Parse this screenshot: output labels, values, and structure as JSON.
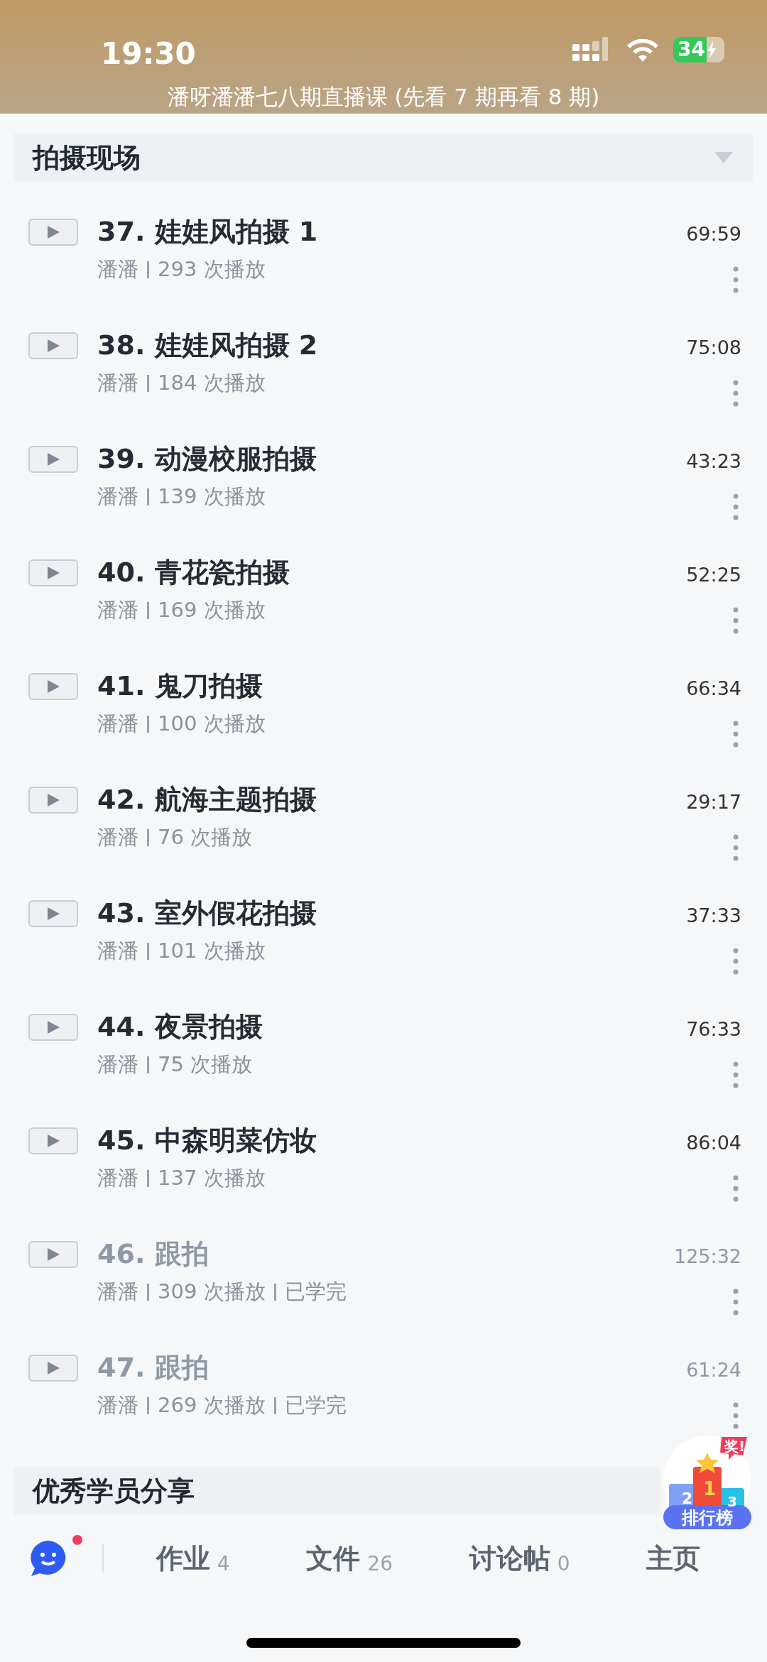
{
  "status_bar": {
    "time": "19:30",
    "battery": "34"
  },
  "course_title": "潘呀潘潘七八期直播课 (先看 7 期再看 8 期)",
  "sections": [
    {
      "title": "拍摄现场",
      "expanded": true,
      "lessons": [
        {
          "title": "37. 娃娃风拍摄 1",
          "author": "潘潘",
          "plays": "293 次播放",
          "duration": "69:59",
          "completed": false
        },
        {
          "title": "38. 娃娃风拍摄 2",
          "author": "潘潘",
          "plays": "184 次播放",
          "duration": "75:08",
          "completed": false
        },
        {
          "title": "39. 动漫校服拍摄",
          "author": "潘潘",
          "plays": "139 次播放",
          "duration": "43:23",
          "completed": false
        },
        {
          "title": "40. 青花瓷拍摄",
          "author": "潘潘",
          "plays": "169 次播放",
          "duration": "52:25",
          "completed": false
        },
        {
          "title": "41. 鬼刀拍摄",
          "author": "潘潘",
          "plays": "100 次播放",
          "duration": "66:34",
          "completed": false
        },
        {
          "title": "42. 航海主题拍摄",
          "author": "潘潘",
          "plays": "76 次播放",
          "duration": "29:17",
          "completed": false
        },
        {
          "title": "43. 室外假花拍摄",
          "author": "潘潘",
          "plays": "101 次播放",
          "duration": "37:33",
          "completed": false
        },
        {
          "title": "44. 夜景拍摄",
          "author": "潘潘",
          "plays": "75 次播放",
          "duration": "76:33",
          "completed": false
        },
        {
          "title": "45. 中森明菜仿妆",
          "author": "潘潘",
          "plays": "137 次播放",
          "duration": "86:04",
          "completed": false
        },
        {
          "title": "46. 跟拍",
          "author": "潘潘",
          "plays": "309 次播放",
          "status": "已学完",
          "duration": "125:32",
          "completed": true
        },
        {
          "title": "47. 跟拍",
          "author": "潘潘",
          "plays": "269 次播放",
          "status": "已学完",
          "duration": "61:24",
          "completed": true
        }
      ]
    },
    {
      "title": "优秀学员分享"
    }
  ],
  "leaderboard": {
    "label": "排行榜",
    "tag": "奖!",
    "places": [
      "2",
      "1",
      "3"
    ]
  },
  "bottom_tabs": [
    {
      "label": "作业",
      "count": "4"
    },
    {
      "label": "文件",
      "count": "26"
    },
    {
      "label": "讨论帖",
      "count": "0"
    },
    {
      "label": "主页"
    }
  ],
  "chat": {
    "unread": true
  }
}
